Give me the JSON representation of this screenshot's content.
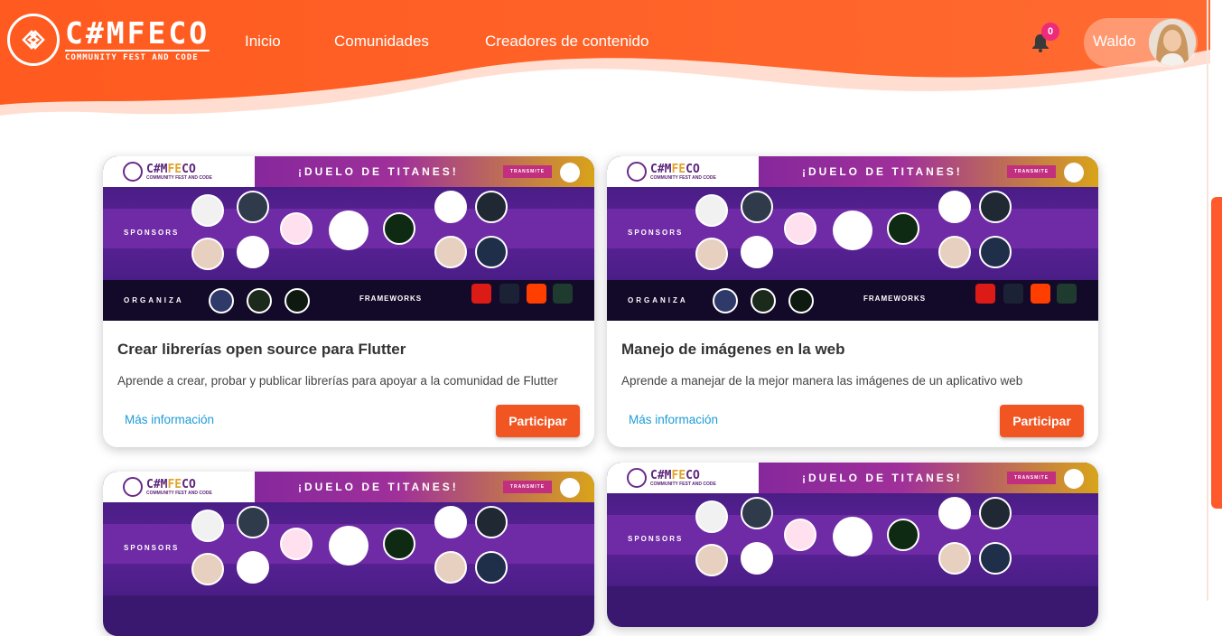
{
  "brand": {
    "title": "C#MFECO",
    "subtitle": "COMMUNITY FEST AND CODE"
  },
  "nav": {
    "items": [
      {
        "label": "Inicio"
      },
      {
        "label": "Comunidades"
      },
      {
        "label": "Creadores de contenido"
      }
    ]
  },
  "notifications": {
    "count": "0"
  },
  "user": {
    "name": "Waldo"
  },
  "banner": {
    "logo_title_a": "C#M",
    "logo_title_b": "FE",
    "logo_title_c": "CO",
    "logo_sub": "COMMUNITY FEST AND CODE",
    "headline": "¡DUELO DE TITANES!",
    "transmite": "TRANSMITE",
    "sponsors": "SPONSORS",
    "organiza": "ORGANIZA",
    "frameworks": "FRAMEWORKS"
  },
  "cards": [
    {
      "title": "Crear librerías open source para Flutter",
      "description": "Aprende a crear, probar y publicar librerías para apoyar a la comunidad de Flutter",
      "more_label": "Más información",
      "action_label": "Participar"
    },
    {
      "title": "Manejo de imágenes en la web",
      "description": "Aprende a manejar de la mejor manera las imágenes de un aplicativo web",
      "more_label": "Más información",
      "action_label": "Participar"
    },
    {
      "title": "",
      "description": "",
      "more_label": "",
      "action_label": ""
    },
    {
      "title": "",
      "description": "",
      "more_label": "",
      "action_label": ""
    }
  ],
  "colors": {
    "accent": "#f05522",
    "link": "#1e9bd7",
    "header_gradient_start": "#ff5a1f",
    "header_gradient_end": "#ff8a4a"
  }
}
